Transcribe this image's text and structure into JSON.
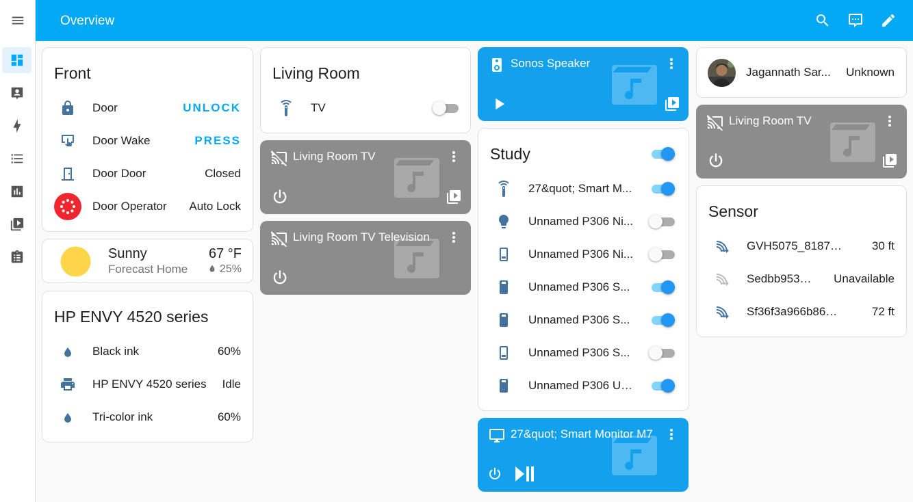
{
  "header": {
    "title": "Overview",
    "icons": [
      "search-icon",
      "assist-icon",
      "edit-icon"
    ]
  },
  "sidebar": {
    "items": [
      {
        "name": "overview",
        "icon": "dashboard-icon",
        "active": true
      },
      {
        "name": "map",
        "icon": "account-box-icon"
      },
      {
        "name": "energy",
        "icon": "lightning-icon"
      },
      {
        "name": "logbook",
        "icon": "list-icon"
      },
      {
        "name": "history",
        "icon": "chart-icon"
      },
      {
        "name": "media",
        "icon": "play-box-icon"
      },
      {
        "name": "todo",
        "icon": "clipboard-icon"
      }
    ]
  },
  "front": {
    "title": "Front",
    "rows": [
      {
        "name": "Door",
        "action": "UNLOCK",
        "icon": "lock-icon"
      },
      {
        "name": "Door Wake",
        "action": "PRESS",
        "icon": "gesture-tap-icon"
      },
      {
        "name": "Door Door",
        "value": "Closed",
        "icon": "door-icon"
      },
      {
        "name": "Door Operator",
        "value": "Auto Lock",
        "icon": "operator-icon"
      }
    ]
  },
  "weather": {
    "condition": "Sunny",
    "location": "Forecast Home",
    "temperature": "67 °F",
    "humidity": "25%"
  },
  "printer": {
    "title": "HP ENVY 4520 series",
    "rows": [
      {
        "name": "Black ink",
        "value": "60%",
        "icon": "water-icon"
      },
      {
        "name": "HP ENVY 4520 series",
        "value": "Idle",
        "icon": "printer-icon"
      },
      {
        "name": "Tri-color ink",
        "value": "60%",
        "icon": "water-icon"
      }
    ]
  },
  "living_room": {
    "title": "Living Room",
    "rows": [
      {
        "name": "TV",
        "on": false,
        "icon": "remote-icon"
      }
    ]
  },
  "media_tv1": {
    "title": "Living Room TV"
  },
  "media_tv2": {
    "title": "Living Room TV Television"
  },
  "sonos": {
    "title": "Sonos Speaker"
  },
  "study": {
    "title": "Study",
    "header_on": true,
    "rows": [
      {
        "name": "27&quot; Smart M...",
        "on": true,
        "icon": "remote-icon"
      },
      {
        "name": "Unnamed P306 Ni...",
        "on": false,
        "icon": "lightbulb-icon"
      },
      {
        "name": "Unnamed P306 Ni...",
        "on": false,
        "icon": "outlet-off-icon"
      },
      {
        "name": "Unnamed P306 S...",
        "on": true,
        "icon": "outlet-on-icon"
      },
      {
        "name": "Unnamed P306 S...",
        "on": true,
        "icon": "outlet-on-icon"
      },
      {
        "name": "Unnamed P306 S...",
        "on": false,
        "icon": "outlet-off-icon"
      },
      {
        "name": "Unnamed P306 US...",
        "on": true,
        "icon": "outlet-on-icon"
      }
    ]
  },
  "monitor": {
    "title": "27&quot; Smart Monitor M7"
  },
  "person": {
    "name": "Jagannath Sar...",
    "state": "Unknown"
  },
  "media_tv3": {
    "title": "Living Room TV"
  },
  "sensor": {
    "title": "Sensor",
    "rows": [
      {
        "name": "GVH5075_8187 Esti...",
        "value": "30 ft",
        "icon": "signal-distance-icon"
      },
      {
        "name": "Sedbb95370...",
        "value": "Unavailable",
        "icon": "signal-distance-icon"
      },
      {
        "name": "Sf36f3a966b86285f...",
        "value": "72 ft",
        "icon": "signal-distance-icon"
      }
    ]
  },
  "colors": {
    "primary": "#03a9f4",
    "media_grey": "#8c8c8c",
    "media_blue": "#13a1ee",
    "icon": "#44739e",
    "operator_red": "#f0262f",
    "sun": "#fdd54b"
  }
}
